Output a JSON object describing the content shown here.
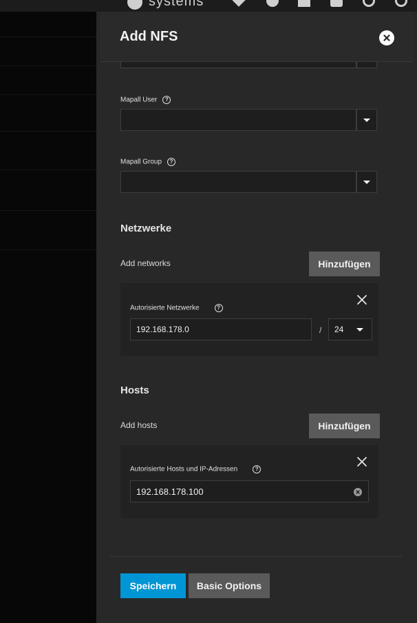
{
  "topbar": {
    "brand": "systems"
  },
  "panel": {
    "title": "Add NFS",
    "mapall_user": {
      "label": "Mapall User",
      "value": ""
    },
    "mapall_group": {
      "label": "Mapall Group",
      "value": ""
    },
    "networks": {
      "title": "Netzwerke",
      "add_label": "Add networks",
      "add_button": "Hinzufügen",
      "item_label": "Autorisierte Netzwerke",
      "address": "192.168.178.0",
      "separator": "/",
      "mask": "24"
    },
    "hosts": {
      "title": "Hosts",
      "add_label": "Add hosts",
      "add_button": "Hinzufügen",
      "item_label": "Autorisierte Hosts und IP-Adressen",
      "value": "192.168.178.100"
    },
    "help_glyph": "?",
    "save_button": "Speichern",
    "basic_options_button": "Basic Options"
  },
  "colors": {
    "primary": "#0095d5",
    "panel_bg": "#282828",
    "button_gray": "#5a5a5a"
  }
}
